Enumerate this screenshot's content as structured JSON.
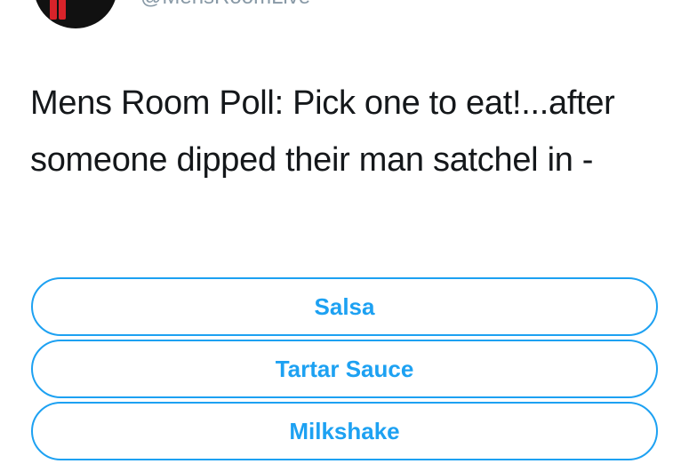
{
  "author": {
    "handle": "@MensRoomLive"
  },
  "tweet": {
    "text": "Mens Room Poll: Pick one to eat!...after someone dipped their man satchel in -"
  },
  "poll": {
    "options": [
      {
        "label": "Salsa"
      },
      {
        "label": "Tartar Sauce"
      },
      {
        "label": "Milkshake"
      }
    ]
  },
  "colors": {
    "accent": "#1da1f2",
    "text": "#14171a",
    "muted": "#8899a6"
  },
  "icons": {
    "avatar": "mens-room-logo-avatar"
  }
}
